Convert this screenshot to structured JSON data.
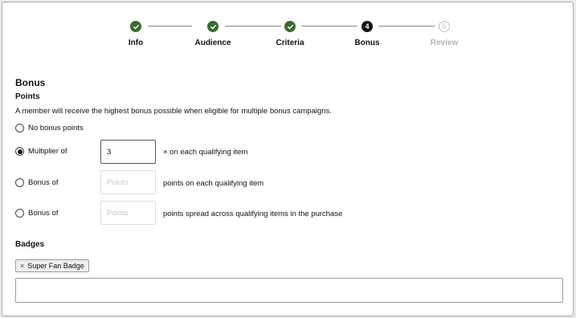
{
  "stepper": {
    "steps": [
      {
        "label": "Info",
        "state": "done",
        "number": ""
      },
      {
        "label": "Audience",
        "state": "done",
        "number": ""
      },
      {
        "label": "Criteria",
        "state": "done",
        "number": ""
      },
      {
        "label": "Bonus",
        "state": "current",
        "number": "4"
      },
      {
        "label": "Review",
        "state": "future",
        "number": "5"
      }
    ]
  },
  "bonus": {
    "title": "Bonus",
    "points_title": "Points",
    "description": "A member will receive the highest bonus possible when eligible for multiple bonus campaigns.",
    "options": {
      "none_label": "No bonus points",
      "multiplier_label": "Multiplier of",
      "multiplier_value": "3",
      "multiplier_suffix": "× on each qualifying item",
      "bonus_each_label": "Bonus of",
      "bonus_each_placeholder": "Points",
      "bonus_each_suffix": "points on each qualifying item",
      "bonus_spread_label": "Bonus of",
      "bonus_spread_placeholder": "Points",
      "bonus_spread_suffix": "points spread across qualifying items in the purchase",
      "selected": "multiplier"
    }
  },
  "badges": {
    "title": "Badges",
    "chips": [
      {
        "label": "Super Fan Badge",
        "remove_icon": "×"
      }
    ]
  },
  "colors": {
    "done": "#3c6b2f",
    "current": "#111111",
    "future": "#bdbdbd"
  }
}
